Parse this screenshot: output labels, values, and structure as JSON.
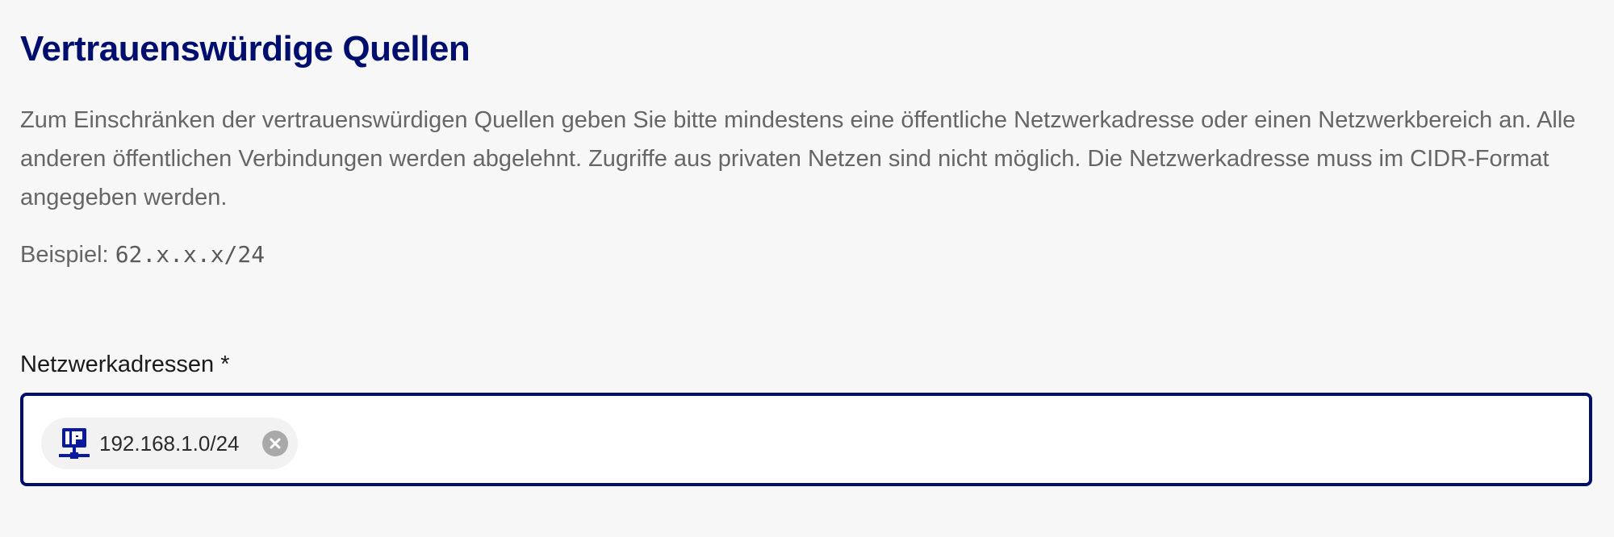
{
  "section": {
    "title": "Vertrauenswürdige Quellen",
    "description": "Zum Einschränken der vertrauenswürdigen Quellen geben Sie bitte mindestens eine öffentliche Netzwerkadresse oder einen Netzwerkbereich an. Alle anderen öffentlichen Verbindungen werden abgelehnt. Zugriffe aus privaten Netzen sind nicht möglich. Die Netzwerkadresse muss im CIDR-Format angegeben werden.",
    "example_label": "Beispiel:",
    "example_value": "62.x.x.x/24"
  },
  "field": {
    "label": "Netzwerkadressen *",
    "chips": [
      {
        "icon": "ip-network-icon",
        "label": "192.168.1.0/24",
        "remove_icon": "close-circle-icon"
      }
    ]
  },
  "colors": {
    "accent": "#000e6e",
    "background": "#f7f7f7",
    "text": "#666666",
    "chip_background": "#f2f2f2",
    "remove_icon": "#a9a9a9"
  }
}
